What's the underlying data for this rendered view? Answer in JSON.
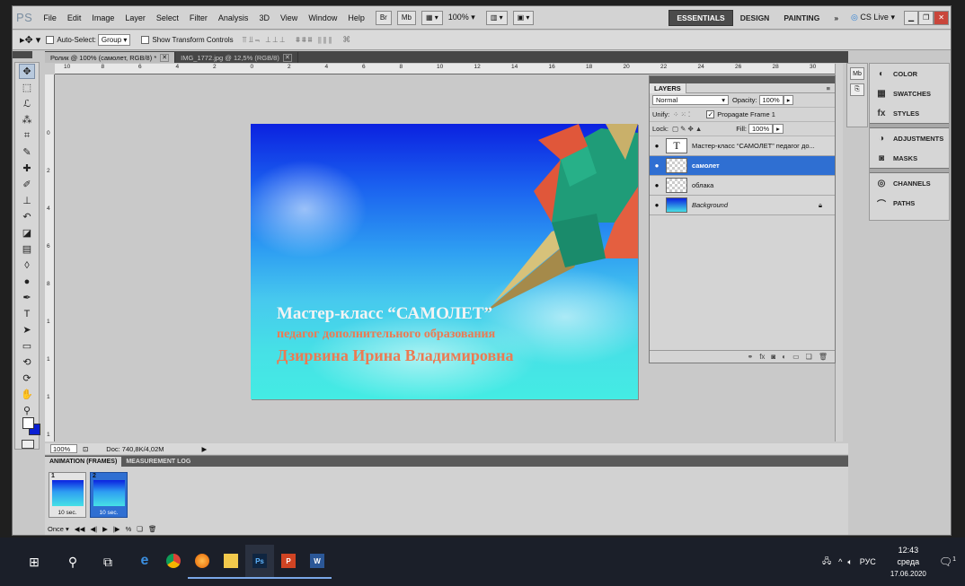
{
  "menubar": {
    "logo": "PS",
    "items": [
      "File",
      "Edit",
      "Image",
      "Layer",
      "Select",
      "Filter",
      "Analysis",
      "3D",
      "View",
      "Window",
      "Help"
    ],
    "bridge": "Br",
    "minibridge": "Mb",
    "zoom": "100%",
    "workspaces": [
      "ESSENTIALS",
      "DESIGN",
      "PAINTING"
    ],
    "more": "»",
    "cslive": "CS Live"
  },
  "options": {
    "auto_select_label": "Auto-Select:",
    "auto_select_value": "Group",
    "show_transform_label": "Show Transform Controls"
  },
  "tabs": [
    {
      "label": "Ролик @ 100% (самолет, RGB/8) *"
    },
    {
      "label": "IMG_1772.jpg @ 12,5% (RGB/8)"
    }
  ],
  "rulers": {
    "h": [
      "10",
      "8",
      "6",
      "4",
      "2",
      "0",
      "2",
      "4",
      "6",
      "8",
      "10",
      "12",
      "14",
      "16",
      "18",
      "20",
      "22",
      "24",
      "26",
      "28",
      "30"
    ],
    "v": [
      "0",
      "2",
      "4",
      "6",
      "8",
      "1",
      "1",
      "1",
      "1",
      "1"
    ]
  },
  "artwork": {
    "title": "Мастер-класс “САМОЛЕТ”",
    "line2": "педагог дополнительного образования",
    "line3": "Дзирвина Ирина Владимировна"
  },
  "statusbar": {
    "zoom": "100%",
    "doc": "Doc: 740,8K/4,02M"
  },
  "layers": {
    "tab": "LAYERS",
    "blend": "Normal",
    "opacity_label": "Opacity:",
    "opacity": "100%",
    "unify_label": "Unify:",
    "propagate_label": "Propagate Frame 1",
    "lock_label": "Lock:",
    "fill_label": "Fill:",
    "fill": "100%",
    "items": [
      {
        "name": "Мастер-класс “САМОЛЕТ” педагог до...",
        "type": "text",
        "thumb": "T"
      },
      {
        "name": "самолет",
        "type": "image"
      },
      {
        "name": "облака",
        "type": "image"
      },
      {
        "name": "Background",
        "type": "background"
      }
    ]
  },
  "right_panel": {
    "items": [
      "COLOR",
      "SWATCHES",
      "STYLES",
      "ADJUSTMENTS",
      "MASKS",
      "CHANNELS",
      "PATHS"
    ]
  },
  "animation": {
    "tabs": [
      "ANIMATION (FRAMES)",
      "MEASUREMENT LOG"
    ],
    "frames": [
      {
        "num": "1",
        "delay": "10 sec."
      },
      {
        "num": "2",
        "delay": "10 sec."
      }
    ],
    "loop": "Once"
  },
  "taskbar": {
    "lang": "РУС",
    "time": "12:43",
    "day": "среда",
    "date": "17.06.2020",
    "notif_count": "1"
  },
  "colors": {
    "accent": "#2f6fd2",
    "fg": "#ffffff",
    "bg": "#0a1fd3"
  }
}
